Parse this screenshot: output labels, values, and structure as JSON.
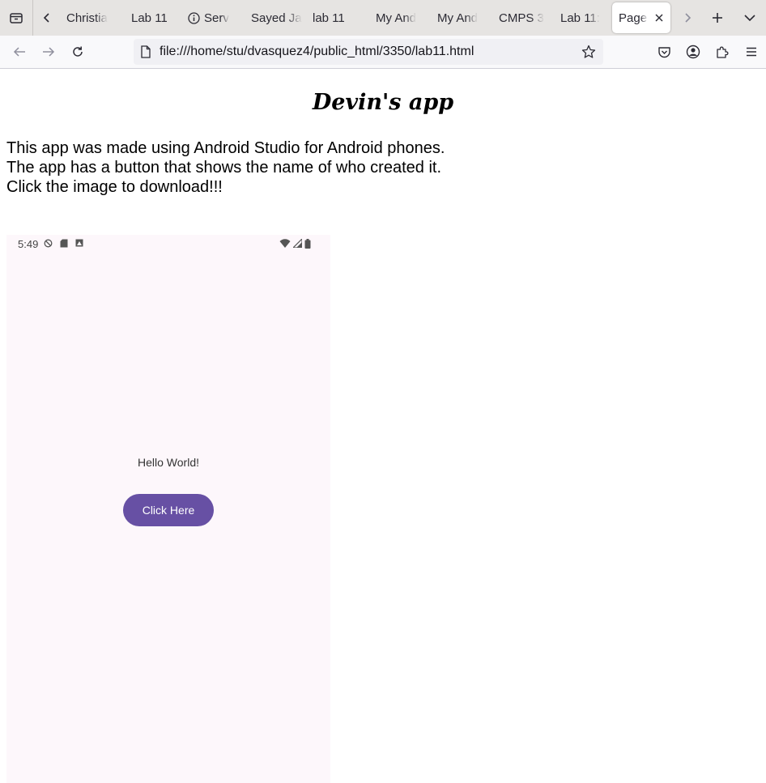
{
  "browser": {
    "tabs": [
      {
        "label": "Christia",
        "fade": true
      },
      {
        "label": "Lab 11",
        "fade": false
      },
      {
        "label": "Serv",
        "fade": true,
        "icon": "info-icon"
      },
      {
        "label": "Sayed Ja",
        "fade": true
      },
      {
        "label": "lab 11",
        "fade": false
      },
      {
        "label": "My And",
        "fade": true
      },
      {
        "label": "My And",
        "fade": true
      },
      {
        "label": "CMPS 3",
        "fade": true
      },
      {
        "label": "Lab 11: ",
        "fade": true
      },
      {
        "label": "Page",
        "fade": true,
        "active": true
      }
    ],
    "url": "file:///home/stu/dvasquez4/public_html/3350/lab11.html"
  },
  "page": {
    "title": "Devin's app",
    "description": [
      "This app was made using Android Studio for Android phones.",
      "The app has a button that shows the name of who created it.",
      "Click the image to download!!!"
    ]
  },
  "phone": {
    "time": "5:49",
    "hello_text": "Hello World!",
    "button_label": "Click Here",
    "button_color": "#6750a4",
    "background": "#fdf7fb"
  }
}
